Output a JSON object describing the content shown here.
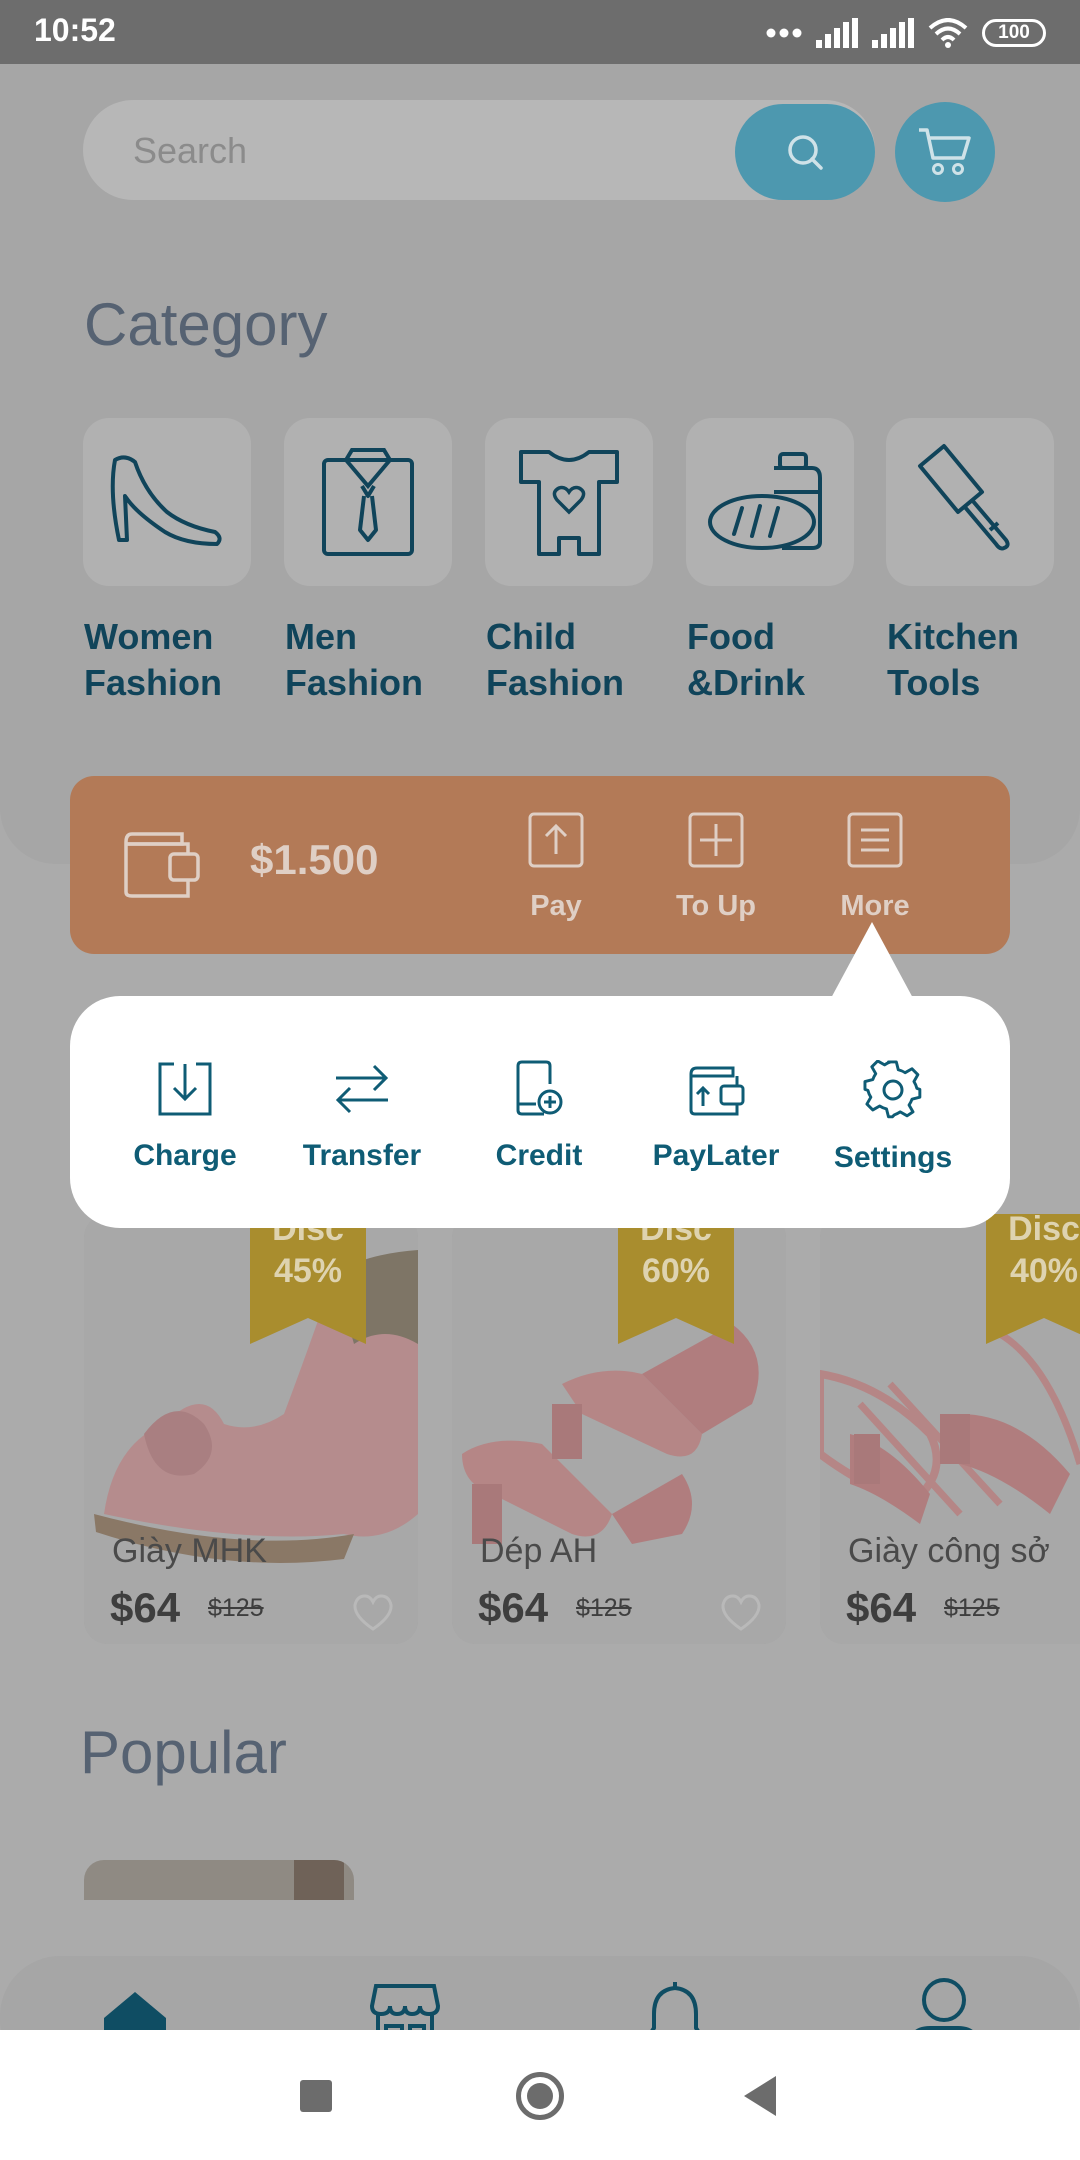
{
  "status_bar": {
    "time": "10:52",
    "battery": "100"
  },
  "search": {
    "placeholder": "Search"
  },
  "category": {
    "title": "Category",
    "items": [
      {
        "label": "Women Fashion",
        "icon": "high-heel-icon"
      },
      {
        "label": "Men Fashion",
        "icon": "shirt-tie-icon"
      },
      {
        "label": "Child Fashion",
        "icon": "baby-onesie-icon"
      },
      {
        "label": "Food &Drink",
        "icon": "bread-bottle-icon"
      },
      {
        "label": "Kitchen Tools",
        "icon": "cleaver-icon"
      }
    ]
  },
  "wallet": {
    "balance": "$1.500",
    "actions": [
      {
        "label": "Pay",
        "icon": "upload-icon"
      },
      {
        "label": "To Up",
        "icon": "plus-square-icon"
      },
      {
        "label": "More",
        "icon": "menu-icon"
      }
    ]
  },
  "more_menu": {
    "items": [
      {
        "label": "Charge",
        "icon": "download-icon"
      },
      {
        "label": "Transfer",
        "icon": "arrows-swap-icon"
      },
      {
        "label": "Credit",
        "icon": "phone-plus-icon"
      },
      {
        "label": "PayLater",
        "icon": "wallet-icon"
      },
      {
        "label": "Settings",
        "icon": "gear-icon"
      }
    ]
  },
  "products": [
    {
      "name": "Giày MHK",
      "price": "$64",
      "old_price": "$125",
      "discount_label": "Disc",
      "discount": "45%"
    },
    {
      "name": "Dép AH",
      "price": "$64",
      "old_price": "$125",
      "discount_label": "Disc",
      "discount": "60%"
    },
    {
      "name": "Giày công sở",
      "price": "$64",
      "old_price": "$125",
      "discount_label": "Disc",
      "discount": "40%"
    }
  ],
  "popular": {
    "title": "Popular"
  },
  "bottom_nav": {
    "items": [
      {
        "icon": "home-icon"
      },
      {
        "icon": "store-icon"
      },
      {
        "icon": "bell-icon"
      },
      {
        "icon": "user-icon"
      }
    ]
  },
  "colors": {
    "accent": "#0f5c75",
    "wallet": "#b37a57",
    "primary_button": "#4d98af",
    "ribbon": "#a98d2e"
  }
}
